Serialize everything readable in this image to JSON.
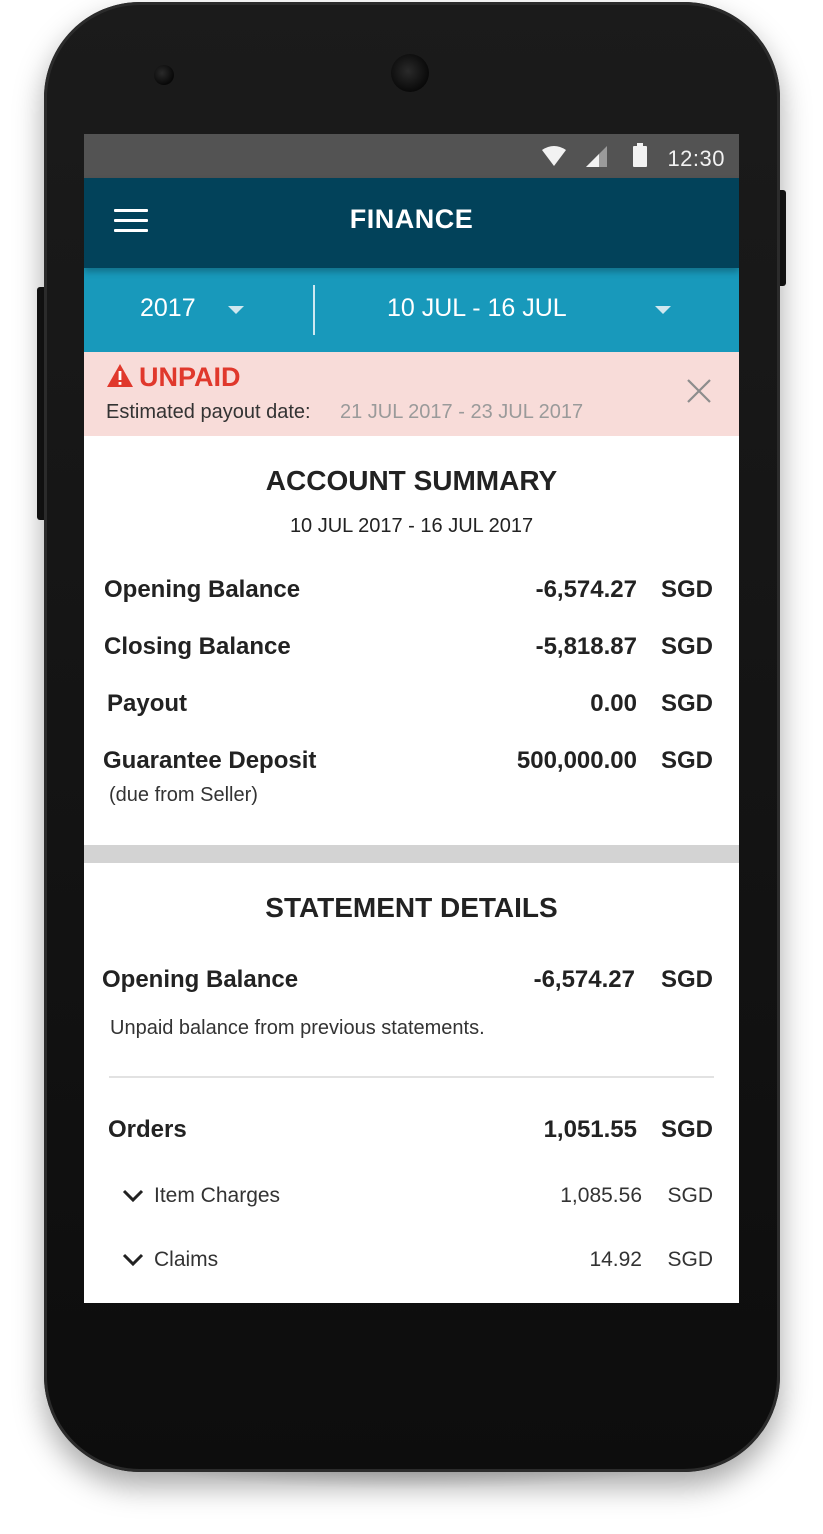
{
  "status_bar": {
    "time": "12:30"
  },
  "app_bar": {
    "title": "FINANCE"
  },
  "filters": {
    "year": "2017",
    "week": "10 JUL - 16 JUL"
  },
  "alert": {
    "status": "UNPAID",
    "label": "Estimated payout date:",
    "dates": "21 JUL 2017 - 23 JUL 2017",
    "status_color": "#e0382c",
    "background": "#f8dcd9"
  },
  "account_summary": {
    "title": "ACCOUNT SUMMARY",
    "period": "10 JUL 2017 - 16 JUL 2017",
    "rows": [
      {
        "label": "Opening Balance",
        "amount": "-6,574.27",
        "currency": "SGD"
      },
      {
        "label": "Closing Balance",
        "amount": "-5,818.87",
        "currency": "SGD"
      },
      {
        "label": "Payout",
        "amount": "0.00",
        "currency": "SGD"
      },
      {
        "label": "Guarantee Deposit",
        "amount": "500,000.00",
        "currency": "SGD",
        "note": "(due from Seller)"
      }
    ]
  },
  "statement_details": {
    "title": "STATEMENT DETAILS",
    "opening": {
      "label": "Opening Balance",
      "amount": "-6,574.27",
      "currency": "SGD",
      "note": "Unpaid balance from previous statements."
    },
    "orders": {
      "label": "Orders",
      "amount": "1,051.55",
      "currency": "SGD",
      "items": [
        {
          "label": "Item Charges",
          "amount": "1,085.56",
          "currency": "SGD"
        },
        {
          "label": "Claims",
          "amount": "14.92",
          "currency": "SGD"
        }
      ]
    }
  },
  "icons": {
    "menu": "hamburger-menu-icon",
    "wifi": "wifi-icon",
    "signal": "signal-icon",
    "battery": "battery-icon",
    "warning": "warning-icon",
    "close": "close-icon",
    "dropdown": "chevron-down-icon"
  },
  "colors": {
    "app_bar": "#02425a",
    "filter_bar": "#1899bb",
    "status_bar": "#535353"
  }
}
